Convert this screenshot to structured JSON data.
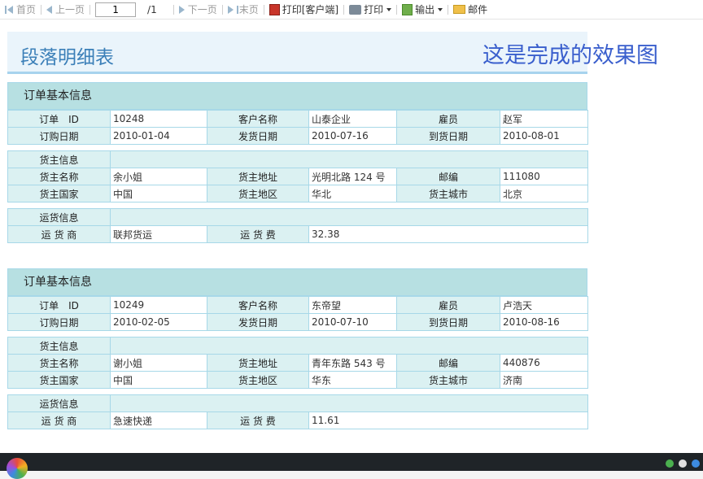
{
  "toolbar": {
    "first": "首页",
    "prev": "上一页",
    "page_input": "1",
    "page_total": "/1",
    "next": "下一页",
    "last": "末页",
    "print_client": "打印[客户端]",
    "print": "打印",
    "export": "输出",
    "mail": "邮件"
  },
  "report": {
    "title": "段落明细表",
    "note": "这是完成的效果图"
  },
  "labels": {
    "section_order": "订单基本信息",
    "order_id": "订单　ID",
    "customer": "客户名称",
    "employee": "雇员",
    "order_date": "订购日期",
    "ship_date": "发货日期",
    "arrive_date": "到货日期",
    "shipper_info": "货主信息",
    "shipper_name": "货主名称",
    "shipper_addr": "货主地址",
    "postcode": "邮编",
    "shipper_country": "货主国家",
    "shipper_region": "货主地区",
    "shipper_city": "货主城市",
    "freight_info": "运货信息",
    "carrier": "运 货 商",
    "freight": "运 货 费"
  },
  "orders": [
    {
      "order_id": "10248",
      "customer": "山泰企业",
      "employee": "赵军",
      "order_date": "2010-01-04",
      "ship_date": "2010-07-16",
      "arrive_date": "2010-08-01",
      "shipper_name": "余小姐",
      "shipper_addr": "光明北路 124 号",
      "postcode": "111080",
      "shipper_country": "中国",
      "shipper_region": "华北",
      "shipper_city": "北京",
      "carrier": "联邦货运",
      "freight": "32.38"
    },
    {
      "order_id": "10249",
      "customer": "东帝望",
      "employee": "卢浩天",
      "order_date": "2010-02-05",
      "ship_date": "2010-07-10",
      "arrive_date": "2010-08-16",
      "shipper_name": "谢小姐",
      "shipper_addr": "青年东路 543 号",
      "postcode": "440876",
      "shipper_country": "中国",
      "shipper_region": "华东",
      "shipper_city": "济南",
      "carrier": "急速快递",
      "freight": "11.61"
    }
  ],
  "colors": {
    "header_bg": "#b7e0e2",
    "label_bg": "#dbf1f2",
    "border": "#a7d8e8",
    "title": "#3b7fb8",
    "note": "#3a5fcd"
  }
}
